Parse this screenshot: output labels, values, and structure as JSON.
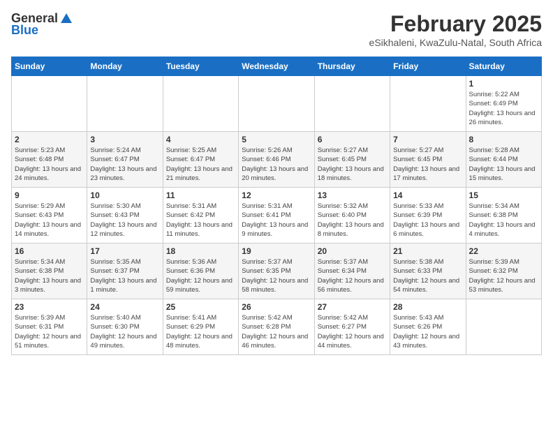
{
  "header": {
    "logo_general": "General",
    "logo_blue": "Blue",
    "title": "February 2025",
    "subtitle": "eSikhaleni, KwaZulu-Natal, South Africa"
  },
  "calendar": {
    "weekdays": [
      "Sunday",
      "Monday",
      "Tuesday",
      "Wednesday",
      "Thursday",
      "Friday",
      "Saturday"
    ],
    "weeks": [
      [
        {
          "day": "",
          "detail": ""
        },
        {
          "day": "",
          "detail": ""
        },
        {
          "day": "",
          "detail": ""
        },
        {
          "day": "",
          "detail": ""
        },
        {
          "day": "",
          "detail": ""
        },
        {
          "day": "",
          "detail": ""
        },
        {
          "day": "1",
          "detail": "Sunrise: 5:22 AM\nSunset: 6:49 PM\nDaylight: 13 hours and 26 minutes."
        }
      ],
      [
        {
          "day": "2",
          "detail": "Sunrise: 5:23 AM\nSunset: 6:48 PM\nDaylight: 13 hours and 24 minutes."
        },
        {
          "day": "3",
          "detail": "Sunrise: 5:24 AM\nSunset: 6:47 PM\nDaylight: 13 hours and 23 minutes."
        },
        {
          "day": "4",
          "detail": "Sunrise: 5:25 AM\nSunset: 6:47 PM\nDaylight: 13 hours and 21 minutes."
        },
        {
          "day": "5",
          "detail": "Sunrise: 5:26 AM\nSunset: 6:46 PM\nDaylight: 13 hours and 20 minutes."
        },
        {
          "day": "6",
          "detail": "Sunrise: 5:27 AM\nSunset: 6:45 PM\nDaylight: 13 hours and 18 minutes."
        },
        {
          "day": "7",
          "detail": "Sunrise: 5:27 AM\nSunset: 6:45 PM\nDaylight: 13 hours and 17 minutes."
        },
        {
          "day": "8",
          "detail": "Sunrise: 5:28 AM\nSunset: 6:44 PM\nDaylight: 13 hours and 15 minutes."
        }
      ],
      [
        {
          "day": "9",
          "detail": "Sunrise: 5:29 AM\nSunset: 6:43 PM\nDaylight: 13 hours and 14 minutes."
        },
        {
          "day": "10",
          "detail": "Sunrise: 5:30 AM\nSunset: 6:43 PM\nDaylight: 13 hours and 12 minutes."
        },
        {
          "day": "11",
          "detail": "Sunrise: 5:31 AM\nSunset: 6:42 PM\nDaylight: 13 hours and 11 minutes."
        },
        {
          "day": "12",
          "detail": "Sunrise: 5:31 AM\nSunset: 6:41 PM\nDaylight: 13 hours and 9 minutes."
        },
        {
          "day": "13",
          "detail": "Sunrise: 5:32 AM\nSunset: 6:40 PM\nDaylight: 13 hours and 8 minutes."
        },
        {
          "day": "14",
          "detail": "Sunrise: 5:33 AM\nSunset: 6:39 PM\nDaylight: 13 hours and 6 minutes."
        },
        {
          "day": "15",
          "detail": "Sunrise: 5:34 AM\nSunset: 6:38 PM\nDaylight: 13 hours and 4 minutes."
        }
      ],
      [
        {
          "day": "16",
          "detail": "Sunrise: 5:34 AM\nSunset: 6:38 PM\nDaylight: 13 hours and 3 minutes."
        },
        {
          "day": "17",
          "detail": "Sunrise: 5:35 AM\nSunset: 6:37 PM\nDaylight: 13 hours and 1 minute."
        },
        {
          "day": "18",
          "detail": "Sunrise: 5:36 AM\nSunset: 6:36 PM\nDaylight: 12 hours and 59 minutes."
        },
        {
          "day": "19",
          "detail": "Sunrise: 5:37 AM\nSunset: 6:35 PM\nDaylight: 12 hours and 58 minutes."
        },
        {
          "day": "20",
          "detail": "Sunrise: 5:37 AM\nSunset: 6:34 PM\nDaylight: 12 hours and 56 minutes."
        },
        {
          "day": "21",
          "detail": "Sunrise: 5:38 AM\nSunset: 6:33 PM\nDaylight: 12 hours and 54 minutes."
        },
        {
          "day": "22",
          "detail": "Sunrise: 5:39 AM\nSunset: 6:32 PM\nDaylight: 12 hours and 53 minutes."
        }
      ],
      [
        {
          "day": "23",
          "detail": "Sunrise: 5:39 AM\nSunset: 6:31 PM\nDaylight: 12 hours and 51 minutes."
        },
        {
          "day": "24",
          "detail": "Sunrise: 5:40 AM\nSunset: 6:30 PM\nDaylight: 12 hours and 49 minutes."
        },
        {
          "day": "25",
          "detail": "Sunrise: 5:41 AM\nSunset: 6:29 PM\nDaylight: 12 hours and 48 minutes."
        },
        {
          "day": "26",
          "detail": "Sunrise: 5:42 AM\nSunset: 6:28 PM\nDaylight: 12 hours and 46 minutes."
        },
        {
          "day": "27",
          "detail": "Sunrise: 5:42 AM\nSunset: 6:27 PM\nDaylight: 12 hours and 44 minutes."
        },
        {
          "day": "28",
          "detail": "Sunrise: 5:43 AM\nSunset: 6:26 PM\nDaylight: 12 hours and 43 minutes."
        },
        {
          "day": "",
          "detail": ""
        }
      ]
    ]
  }
}
